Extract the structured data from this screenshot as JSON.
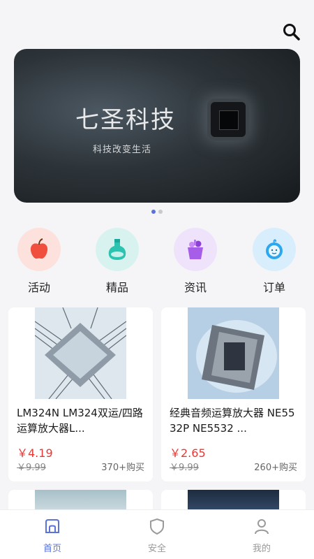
{
  "banner": {
    "title": "七圣科技",
    "subtitle": "科技改变生活"
  },
  "categories": [
    {
      "label": "活动",
      "icon": "apple-icon",
      "bg": "#fde1dc"
    },
    {
      "label": "精品",
      "icon": "potion-icon",
      "bg": "#d8f3ef"
    },
    {
      "label": "资讯",
      "icon": "basket-icon",
      "bg": "#efe3fb"
    },
    {
      "label": "订单",
      "icon": "baby-icon",
      "bg": "#d8eefc"
    }
  ],
  "products": [
    {
      "title": "LM324N LM324双运/四路运算放大器L...",
      "price": "￥4.19",
      "original": "￥9.99",
      "sold": "370+购买"
    },
    {
      "title": "经典音频运算放大器 NE5532P NE5532 ...",
      "price": "￥2.65",
      "original": "￥9.99",
      "sold": "260+购买"
    }
  ],
  "tabs": [
    {
      "label": "首页",
      "icon": "home-icon",
      "active": true
    },
    {
      "label": "安全",
      "icon": "shield-icon",
      "active": false
    },
    {
      "label": "我的",
      "icon": "user-icon",
      "active": false
    }
  ],
  "colors": {
    "accent": "#5b73d9",
    "price": "#e53935"
  }
}
